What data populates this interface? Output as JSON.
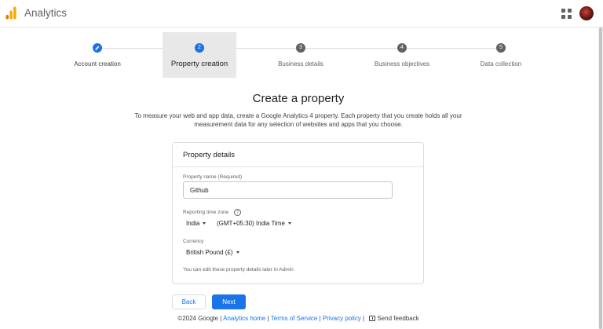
{
  "header": {
    "app_title": "Analytics",
    "logo_icon": "analytics-bars-icon",
    "apps_icon": "apps-grid-icon",
    "avatar_icon": "account-avatar"
  },
  "stepper": {
    "steps": [
      {
        "number": "",
        "label": "Account creation",
        "state": "done",
        "icon": "pencil-icon"
      },
      {
        "number": "2",
        "label": "Property creation",
        "state": "current"
      },
      {
        "number": "3",
        "label": "Business details",
        "state": "pending"
      },
      {
        "number": "4",
        "label": "Business objectives",
        "state": "pending"
      },
      {
        "number": "5",
        "label": "Data collection",
        "state": "pending"
      }
    ]
  },
  "main": {
    "title": "Create a property",
    "description": "To measure your web and app data, create a Google Analytics 4 property. Each property that you create holds all your measurement data for any selection of websites and apps that you choose."
  },
  "card": {
    "title": "Property details",
    "property_name_label": "Property name (Required)",
    "property_name_value": "Github",
    "timezone_label": "Reporting time zone",
    "help_icon": "help-circle-icon",
    "country": "India",
    "timezone": "(GMT+05:30) India Time",
    "currency_label": "Currency",
    "currency": "British Pound (£)",
    "admin_note": "You can edit these property details later in Admin"
  },
  "buttons": {
    "back": "Back",
    "next": "Next"
  },
  "footer": {
    "copyright": "©2024 Google",
    "sep": "|",
    "analytics_home": "Analytics home",
    "terms": "Terms of Service",
    "privacy": "Privacy policy",
    "feedback": "Send feedback",
    "feedback_icon": "feedback-icon"
  },
  "colors": {
    "accent": "#1a73e8",
    "logo_orange_dark": "#e37400",
    "logo_orange_light": "#f9ab00"
  }
}
